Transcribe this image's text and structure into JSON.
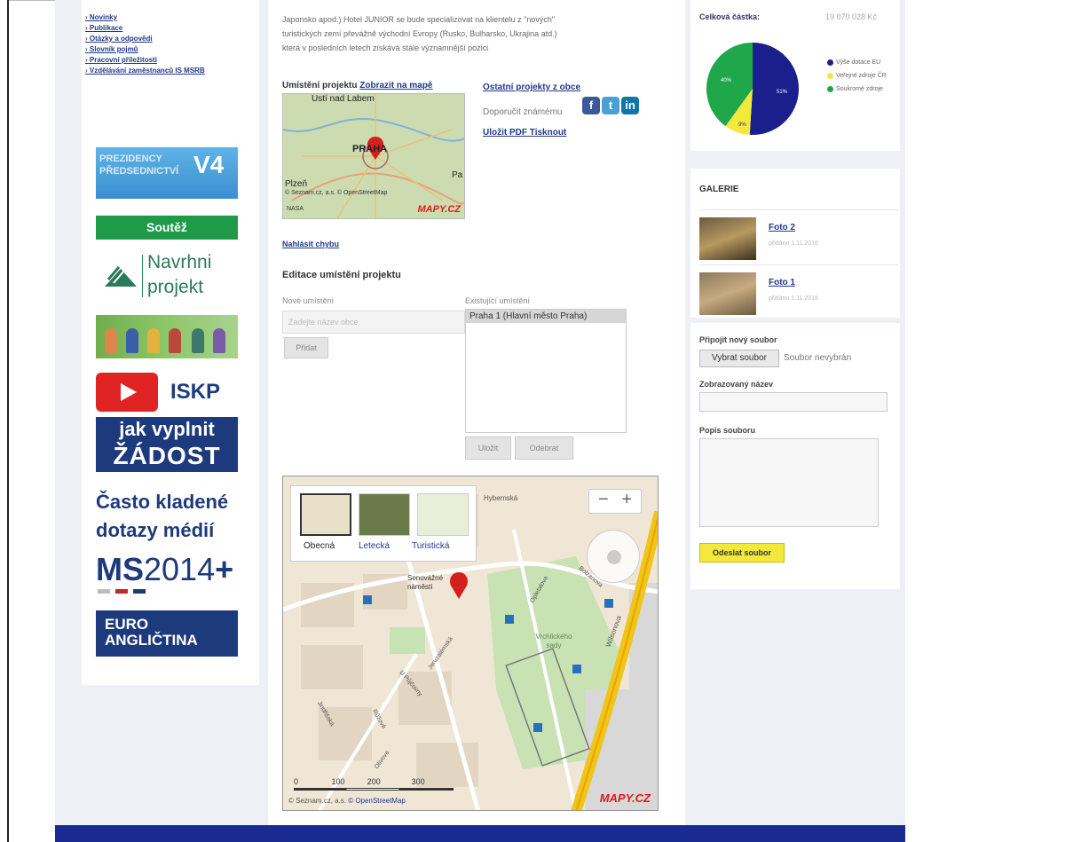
{
  "left_nav": [
    "Novinky",
    "Publikace",
    "Otázky a odpovědi",
    "Slovník pojmů",
    "Pracovní příležitosti",
    "Vzdělávání zaměstnanců IS MSRB"
  ],
  "banners": {
    "predsednictvi_line1": "PREZIDENCY",
    "predsednictvi_line2": "PŘEDSEDNICTVÍ",
    "predsednictvi_v4": "V4",
    "soutez": "Soutěž",
    "navrhni_line1": "Navrhni",
    "navrhni_line2": "projekt",
    "iskp": "ISKP",
    "zadost_line1": "jak vyplnit",
    "zadost_line2": "ŽÁDOST",
    "casto_line1": "Často kladené",
    "casto_line2": "dotazy médií",
    "ms_bold": "MS",
    "ms_rest": "2014",
    "ms_plus": "+",
    "euro_line1": "EURO",
    "euro_line2": "ANGLIČTINA"
  },
  "center": {
    "intro_line1": "Japonsko apod.) Hotel JUNIOR se bude specializovat na klientelu z \"nových\"",
    "intro_line2": "turistických zemí převážně východní Evropy (Rusko, Bulharsko, Ukrajina atd.)",
    "intro_line3": "která v posledních letech získává stále významnější pozici",
    "location_label": "Umístění projektu",
    "show_on_map": "Zobrazit na mapě",
    "minimap_city_top": "Ústí nad Labem",
    "minimap_city": "PRAHA",
    "minimap_city_left": "Plzeň",
    "minimap_city_right": "Pa",
    "minimap_copyright": "© Seznam.cz, a.s. © OpenStreetMap",
    "minimap_nasa": "NASA",
    "minimap_logo": "MAPY.CZ",
    "other_projects": "Ostatní projekty z obce",
    "recommend": "Doporučit známému",
    "save_pdf": "Uložit PDF",
    "print": "Tisknout",
    "report_error": "Nahlásit chybu",
    "edit_title": "Editace umístění projektu",
    "new_location_label": "Nové umístění",
    "new_location_placeholder": "Zadejte název obce",
    "add_button": "Přidat",
    "existing_location_label": "Existující umístění",
    "existing_locations": [
      "Praha 1 (Hlavní město Praha)"
    ],
    "save_button": "Uložit",
    "remove_button": "Odebrat",
    "map_types": [
      "Obecná",
      "Letecká",
      "Turistická"
    ],
    "map_street_labels": [
      "Hybernská",
      "Senovážné náměstí",
      "Bolzanova",
      "Opletalova",
      "Vrchlického sady",
      "Wilsonova",
      "Jeruzalémská",
      "U Půjčovny",
      "Jindřišská",
      "Růžová",
      "Olivova"
    ],
    "map_scale": [
      "0",
      "100",
      "200",
      "300"
    ],
    "map_copyright_prefix": "© Seznam.cz, a.s.",
    "map_copyright_link": "© OpenStreetMap",
    "map_logo": "MAPY.CZ"
  },
  "right": {
    "total_label": "Celková částka:",
    "total_value": "19 070 028 Kč",
    "pie": {
      "type": "pie",
      "slices": [
        {
          "name": "Výše dotace EU",
          "pct": 51,
          "color": "#1a1f8c"
        },
        {
          "name": "Veřejné zdroje ČR",
          "pct": 9,
          "color": "#f2e93a"
        },
        {
          "name": "Soukromé zdroje",
          "pct": 40,
          "color": "#1fa74a"
        }
      ]
    },
    "legend_eu": "Výše dotace EU",
    "legend_cr": "Veřejné zdroje ČR",
    "legend_private": "Soukromé zdroje",
    "pie_label_51": "51%",
    "pie_label_40": "40%",
    "pie_label_9": "9%",
    "gallery_title": "GALERIE",
    "gallery": [
      {
        "name": "Foto 2",
        "meta": "přidáno 1.11.2016"
      },
      {
        "name": "Foto 1",
        "meta": "přidáno 1.11.2016"
      }
    ],
    "attach_label": "Připojit nový soubor",
    "choose_file": "Vybrat soubor",
    "no_file": "Soubor nevybrán",
    "display_name_label": "Zobrazovaný název",
    "description_label": "Popis souboru",
    "send_button": "Odeslat soubor"
  }
}
